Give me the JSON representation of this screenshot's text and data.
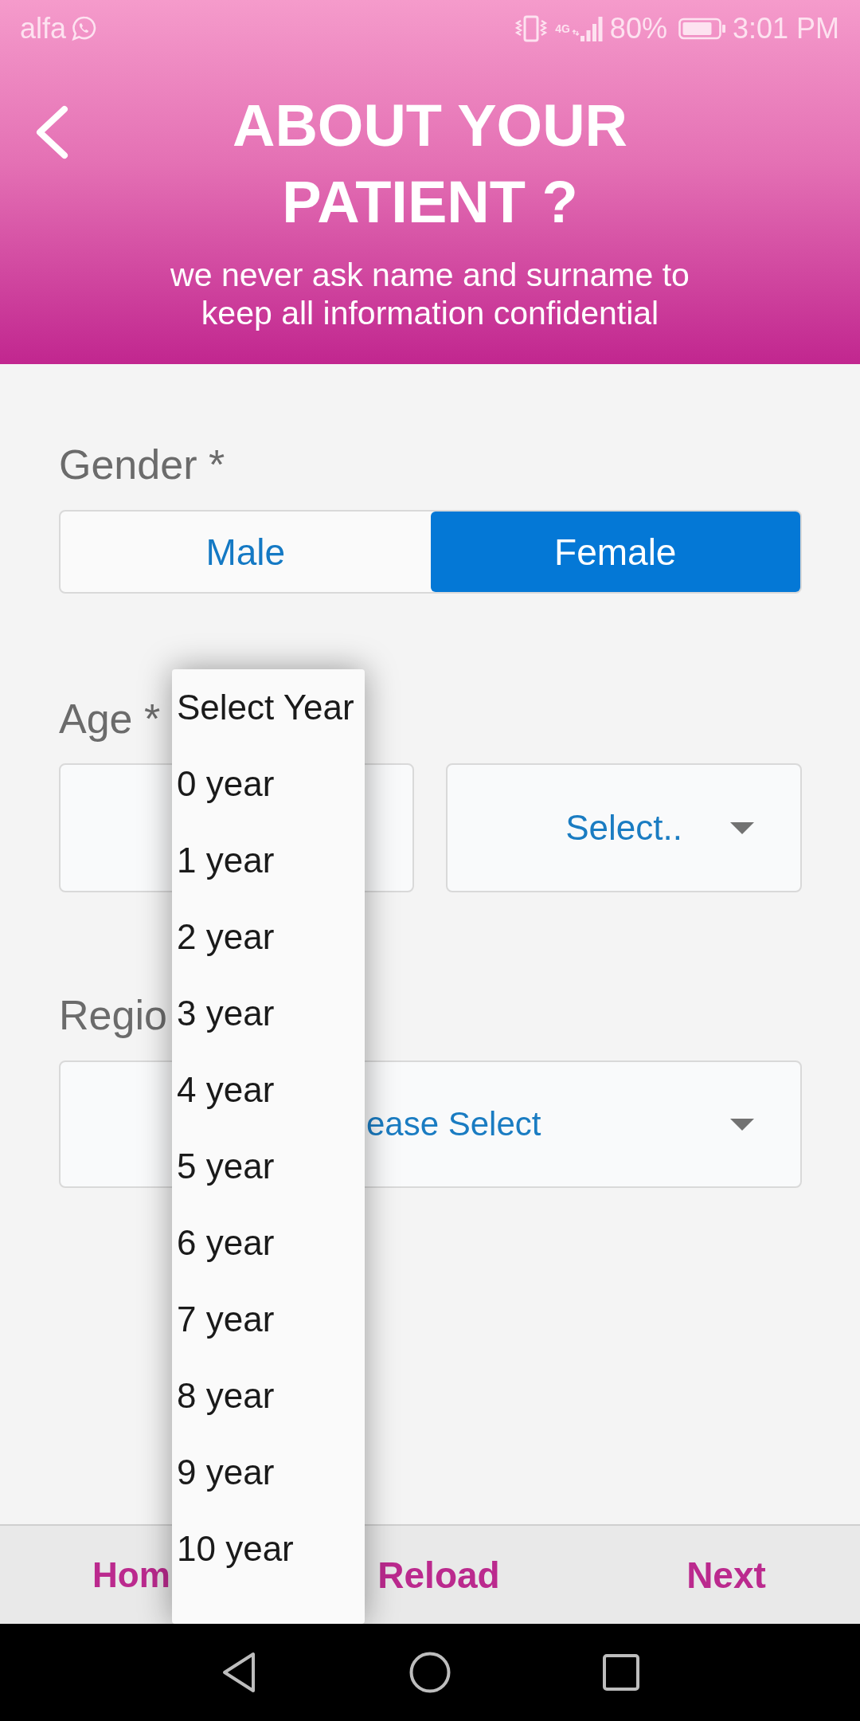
{
  "status_bar": {
    "carrier": "alfa",
    "network": "4G",
    "battery": "80%",
    "time": "3:01 PM"
  },
  "header": {
    "title": "ABOUT YOUR PATIENT ?",
    "subtitle": "we never ask name and surname to keep all information confidential"
  },
  "form": {
    "gender": {
      "label": "Gender *",
      "options": [
        {
          "label": "Male",
          "selected": false
        },
        {
          "label": "Female",
          "selected": true
        }
      ]
    },
    "age": {
      "label": "Age *",
      "unit_select": {
        "value": "Select.."
      }
    },
    "region": {
      "label": "Regio",
      "select": {
        "value": "ease Select"
      }
    }
  },
  "year_dropdown": {
    "options": [
      {
        "label": "Select Year",
        "selected": false
      },
      {
        "label": "0 year",
        "selected": false
      },
      {
        "label": "1 year",
        "selected": false
      },
      {
        "label": "2 year",
        "selected": false
      },
      {
        "label": "3 year",
        "selected": false
      },
      {
        "label": "4 year",
        "selected": false
      },
      {
        "label": "5 year",
        "selected": false
      },
      {
        "label": "6 year",
        "selected": false
      },
      {
        "label": "7 year",
        "selected": false
      },
      {
        "label": "8 year",
        "selected": false
      },
      {
        "label": "9 year",
        "selected": false
      },
      {
        "label": "10 year",
        "selected": false
      }
    ]
  },
  "bottom_bar": {
    "buttons": [
      "Hom",
      "Reload",
      "Next"
    ]
  }
}
